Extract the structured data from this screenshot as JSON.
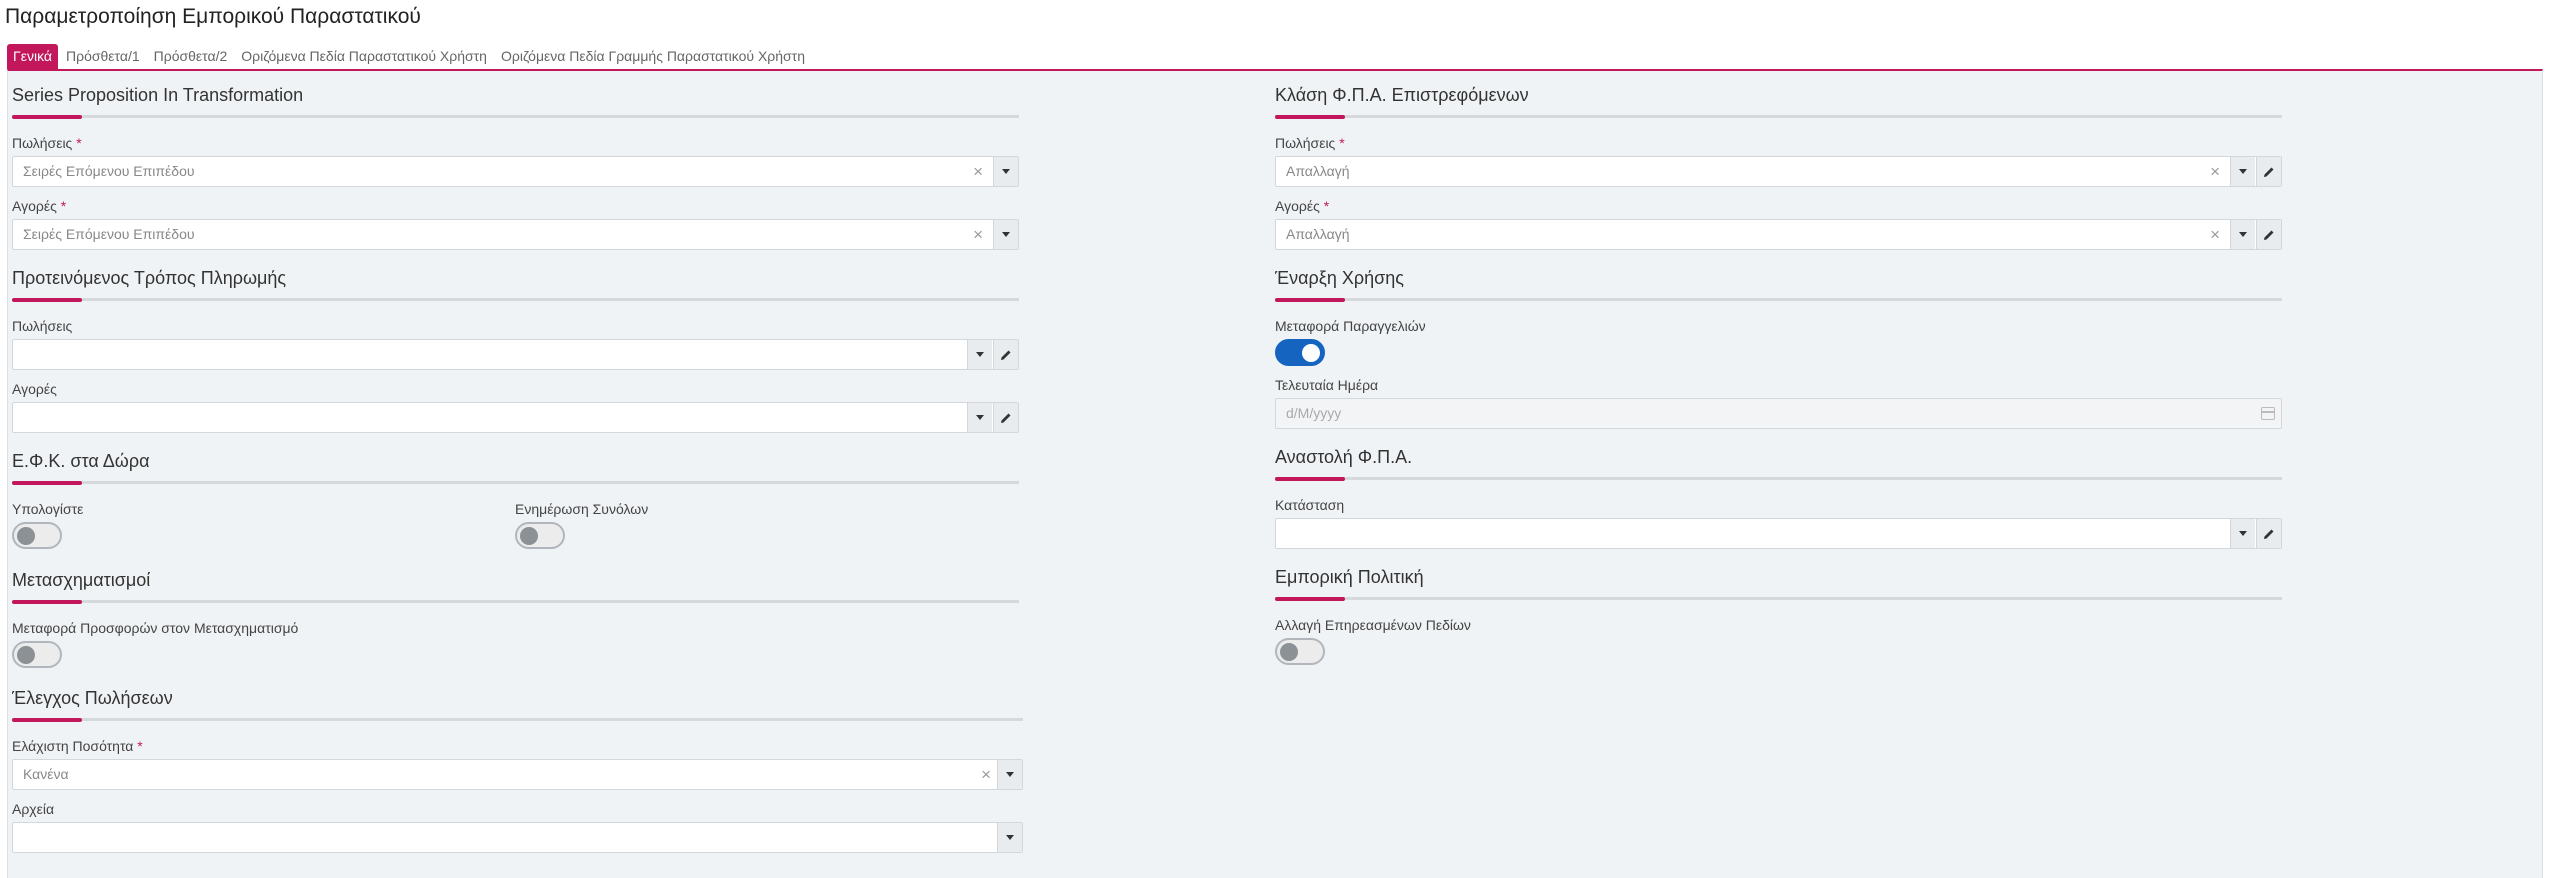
{
  "page": {
    "title": "Παραμετροποίηση Εμπορικού Παραστατικού"
  },
  "tabs": [
    {
      "label": "Γενικά",
      "active": true
    },
    {
      "label": "Πρόσθετα/1"
    },
    {
      "label": "Πρόσθετα/2"
    },
    {
      "label": "Οριζόμενα Πεδία Παραστατικού Χρήστη"
    },
    {
      "label": "Οριζόμενα Πεδία Γραμμής Παραστατικού Χρήστη"
    }
  ],
  "series": {
    "title": "Series Proposition In Transformation",
    "sales_label": "Πωλήσεις",
    "sales_value": "Σειρές Επόμενου Επιπέδου",
    "purchases_label": "Αγορές",
    "purchases_value": "Σειρές Επόμενου Επιπέδου"
  },
  "payment": {
    "title": "Προτεινόμενος Τρόπος Πληρωμής",
    "sales_label": "Πωλήσεις",
    "sales_value": "",
    "purchases_label": "Αγορές",
    "purchases_value": ""
  },
  "efk": {
    "title": "Ε.Φ.Κ. στα Δώρα",
    "calc_label": "Υπολογίστε",
    "calc_on": false,
    "update_label": "Ενημέρωση Συνόλων",
    "update_on": false
  },
  "transform": {
    "title": "Μετασχηματισμοί",
    "offers_label": "Μεταφορά Προσφορών στον Μετασχηματισμό",
    "offers_on": false
  },
  "sales_control": {
    "title": "Έλεγχος Πωλήσεων",
    "min_qty_label": "Ελάχιστη Ποσότητα",
    "min_qty_value": "Κανένα",
    "files_label": "Αρχεία",
    "files_value": ""
  },
  "vat_class": {
    "title": "Κλάση Φ.Π.Α. Επιστρεφόμενων",
    "sales_label": "Πωλήσεις",
    "sales_value": "Απαλλαγή",
    "purchases_label": "Αγορές",
    "purchases_value": "Απαλλαγή"
  },
  "start_use": {
    "title": "Έναρξη Χρήσης",
    "orders_label": "Μεταφορά Παραγγελιών",
    "orders_on": true,
    "last_day_label": "Τελευταία Ημέρα",
    "last_day_placeholder": "d/M/yyyy"
  },
  "vat_suspend": {
    "title": "Αναστολή Φ.Π.Α.",
    "status_label": "Κατάσταση",
    "status_value": ""
  },
  "policy": {
    "title": "Εμπορική Πολιτική",
    "change_label": "Αλλαγή Επηρεασμένων Πεδίων",
    "change_on": false
  },
  "colors": {
    "accent": "#c2185b",
    "toggle_on": "#1565c0"
  }
}
